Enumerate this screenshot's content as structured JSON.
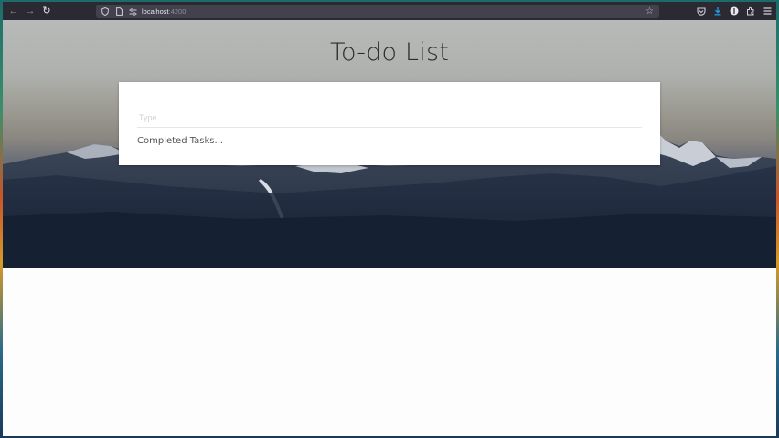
{
  "browser": {
    "url_host": "localhost",
    "url_port": ":4200",
    "icons": {
      "back": "back-arrow-icon",
      "forward": "forward-arrow-icon",
      "reload": "reload-icon",
      "shield": "shield-icon",
      "page": "page-icon",
      "permissions": "permissions-icon",
      "bookmark": "star-icon",
      "pocket": "pocket-icon",
      "downloads": "download-icon",
      "account": "account-icon",
      "extensions": "extensions-icon",
      "menu": "hamburger-menu-icon"
    }
  },
  "app": {
    "title": "To-do List",
    "input_placeholder": "Type...",
    "completed_label": "Completed Tasks..."
  },
  "colors": {
    "toolbar": "#2b2a33",
    "urlbar": "#42414d",
    "card": "#ffffff",
    "page_background": "#fdfdfd",
    "download_accent": "#1ea1e6"
  }
}
